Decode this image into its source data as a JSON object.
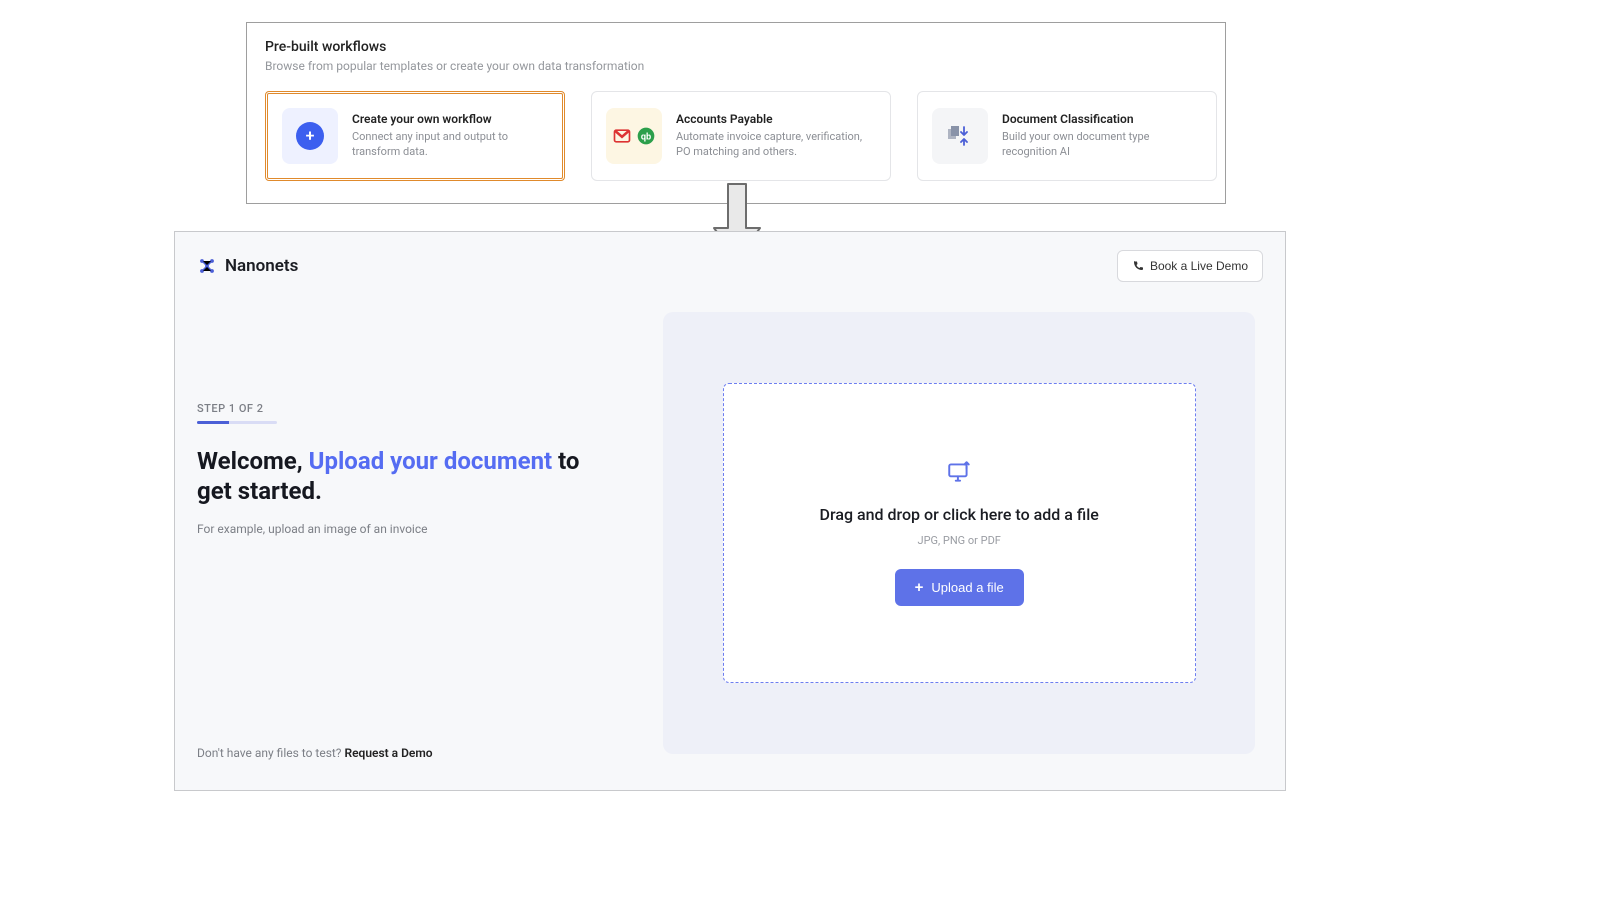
{
  "workflows": {
    "heading": "Pre-built workflows",
    "subheading": "Browse from popular templates or create your own data transformation",
    "cards": [
      {
        "title": "Create your own workflow",
        "desc": "Connect any input and output to transform data.",
        "icon": "plus-circle"
      },
      {
        "title": "Accounts Payable",
        "desc": "Automate invoice capture, verification, PO matching and others.",
        "icon": "gmail-qb"
      },
      {
        "title": "Document Classification",
        "desc": "Build your own document type recognition AI",
        "icon": "doc-split"
      }
    ]
  },
  "app": {
    "brand": "Nanonets",
    "demo_button": "Book a Live Demo",
    "step_label": "STEP 1 OF 2",
    "progress_pct": 50,
    "welcome_pre": "Welcome, ",
    "welcome_highlight": "Upload your document",
    "welcome_post": " to get started.",
    "example_text": "For example, upload an image of an invoice",
    "footer_pre": "Don't have any files to test? ",
    "footer_link": "Request a Demo",
    "drop": {
      "title": "Drag and drop or click here to add a file",
      "formats": "JPG, PNG or PDF",
      "button": "Upload a file"
    }
  }
}
